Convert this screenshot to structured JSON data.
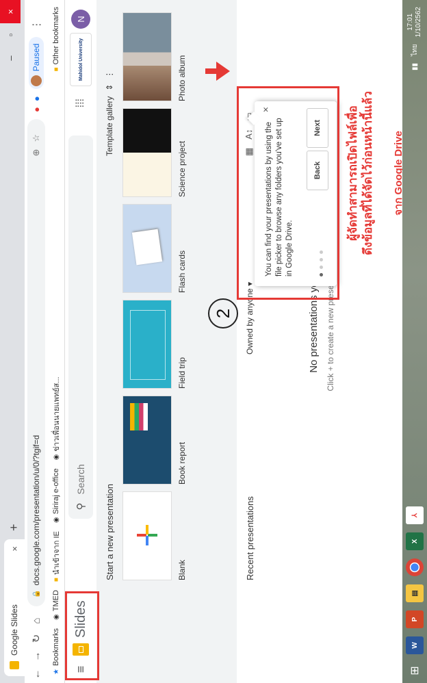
{
  "browser": {
    "tab_title": "Google Slides",
    "tab_close": "×",
    "new_tab": "+",
    "window_controls": [
      "–",
      "▫",
      "×"
    ],
    "url": "docs.google.com/presentation/u/0/?tgif=d",
    "profile_status": "Paused",
    "bookmarks": [
      "Bookmarks",
      "TMED",
      "นำเข้าจาก IE",
      "Siriraj e-office",
      "ข่าวเพื่อนนายแพทย์ส..."
    ],
    "other_bookmarks": "Other bookmarks"
  },
  "app": {
    "title": "Slides",
    "search_placeholder": "Search",
    "avatar_letter": "N",
    "org_badge": "Mahidol University"
  },
  "gallery": {
    "heading": "Start a new presentation",
    "template_gallery": "Template gallery",
    "templates": [
      {
        "label": "Blank"
      },
      {
        "label": "Book report"
      },
      {
        "label": "Field trip"
      },
      {
        "label": "Flash cards"
      },
      {
        "label": "Science project"
      },
      {
        "label": "Photo album"
      }
    ]
  },
  "recent": {
    "heading": "Recent presentations",
    "owned_filter": "Owned by anyone ▾",
    "empty_title": "No presentations yet",
    "empty_sub": "Click + to create a new presentation"
  },
  "tooltip": {
    "text": "You can find your presentations by using the file picker to browse any folders you've set up in Google Drive.",
    "back": "Back",
    "next": "Next",
    "close": "×"
  },
  "annotation": {
    "step_number": "2",
    "note_line1": "ผู้จัดทำสามารถเปิดไฟล์เพื่อ",
    "note_line2": "ดึงข้อมูลที่ได้จัดไว้ก่อนหน้านี้แล้ว",
    "note_line3": "จาก Google Drive",
    "color": "#e53935"
  },
  "taskbar": {
    "apps": [
      "W",
      "P",
      "",
      "",
      "X",
      ""
    ],
    "lang": "ไทย",
    "time": "17:01",
    "date": "1/10/2562"
  }
}
